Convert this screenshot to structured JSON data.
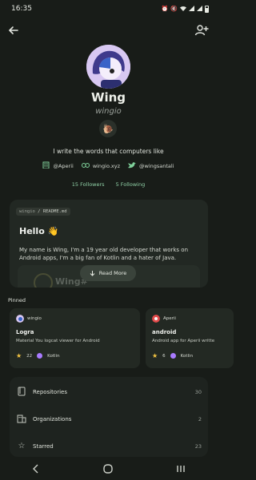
{
  "status_bar": {
    "time": "16:35",
    "icons": [
      "alarm-icon",
      "mute-icon",
      "wifi-icon",
      "signal-icon",
      "signal-icon",
      "battery-icon"
    ]
  },
  "toolbar": {
    "back_icon": "arrow-left-icon",
    "follow_icon": "person-add-icon"
  },
  "profile": {
    "name": "Wing",
    "username": "wingio",
    "status_emoji": "🐌",
    "bio": "I write the words that computers like",
    "links": [
      {
        "icon": "building-icon",
        "text": "@Aperii"
      },
      {
        "icon": "link-icon",
        "text": "wingio.xyz"
      },
      {
        "icon": "twitter-icon",
        "text": "@wingsantali"
      }
    ],
    "followers": "15 Followers",
    "following": "5 Following"
  },
  "readme": {
    "repo": "wingio",
    "file": "README.md",
    "heading": "Hello 👋",
    "body": "My name is Wing, I'm a 19 year old developer that works on Android apps, I'm a big fan of Kotlin and a hater of Java.",
    "faded_text": "Wing#",
    "read_more_label": "Read More"
  },
  "pinned": {
    "label": "Pinned",
    "repos": [
      {
        "owner": "wingio",
        "name": "Logra",
        "description": "Material You logcat viewer for Android",
        "stars": "22",
        "language": "Kotlin",
        "language_color": "#a97bff"
      },
      {
        "owner": "Aperii",
        "name": "android",
        "description": "Android app for Aperii writte",
        "stars": "6",
        "language": "Kotlin",
        "language_color": "#a97bff"
      }
    ]
  },
  "menu": [
    {
      "icon": "repository-icon",
      "label": "Repositories",
      "count": "30"
    },
    {
      "icon": "organization-icon",
      "label": "Organizations",
      "count": "2"
    },
    {
      "icon": "star-icon",
      "label": "Starred",
      "count": "23"
    }
  ],
  "nav_bar": [
    "recent-apps-icon",
    "home-icon",
    "back-nav-icon"
  ]
}
